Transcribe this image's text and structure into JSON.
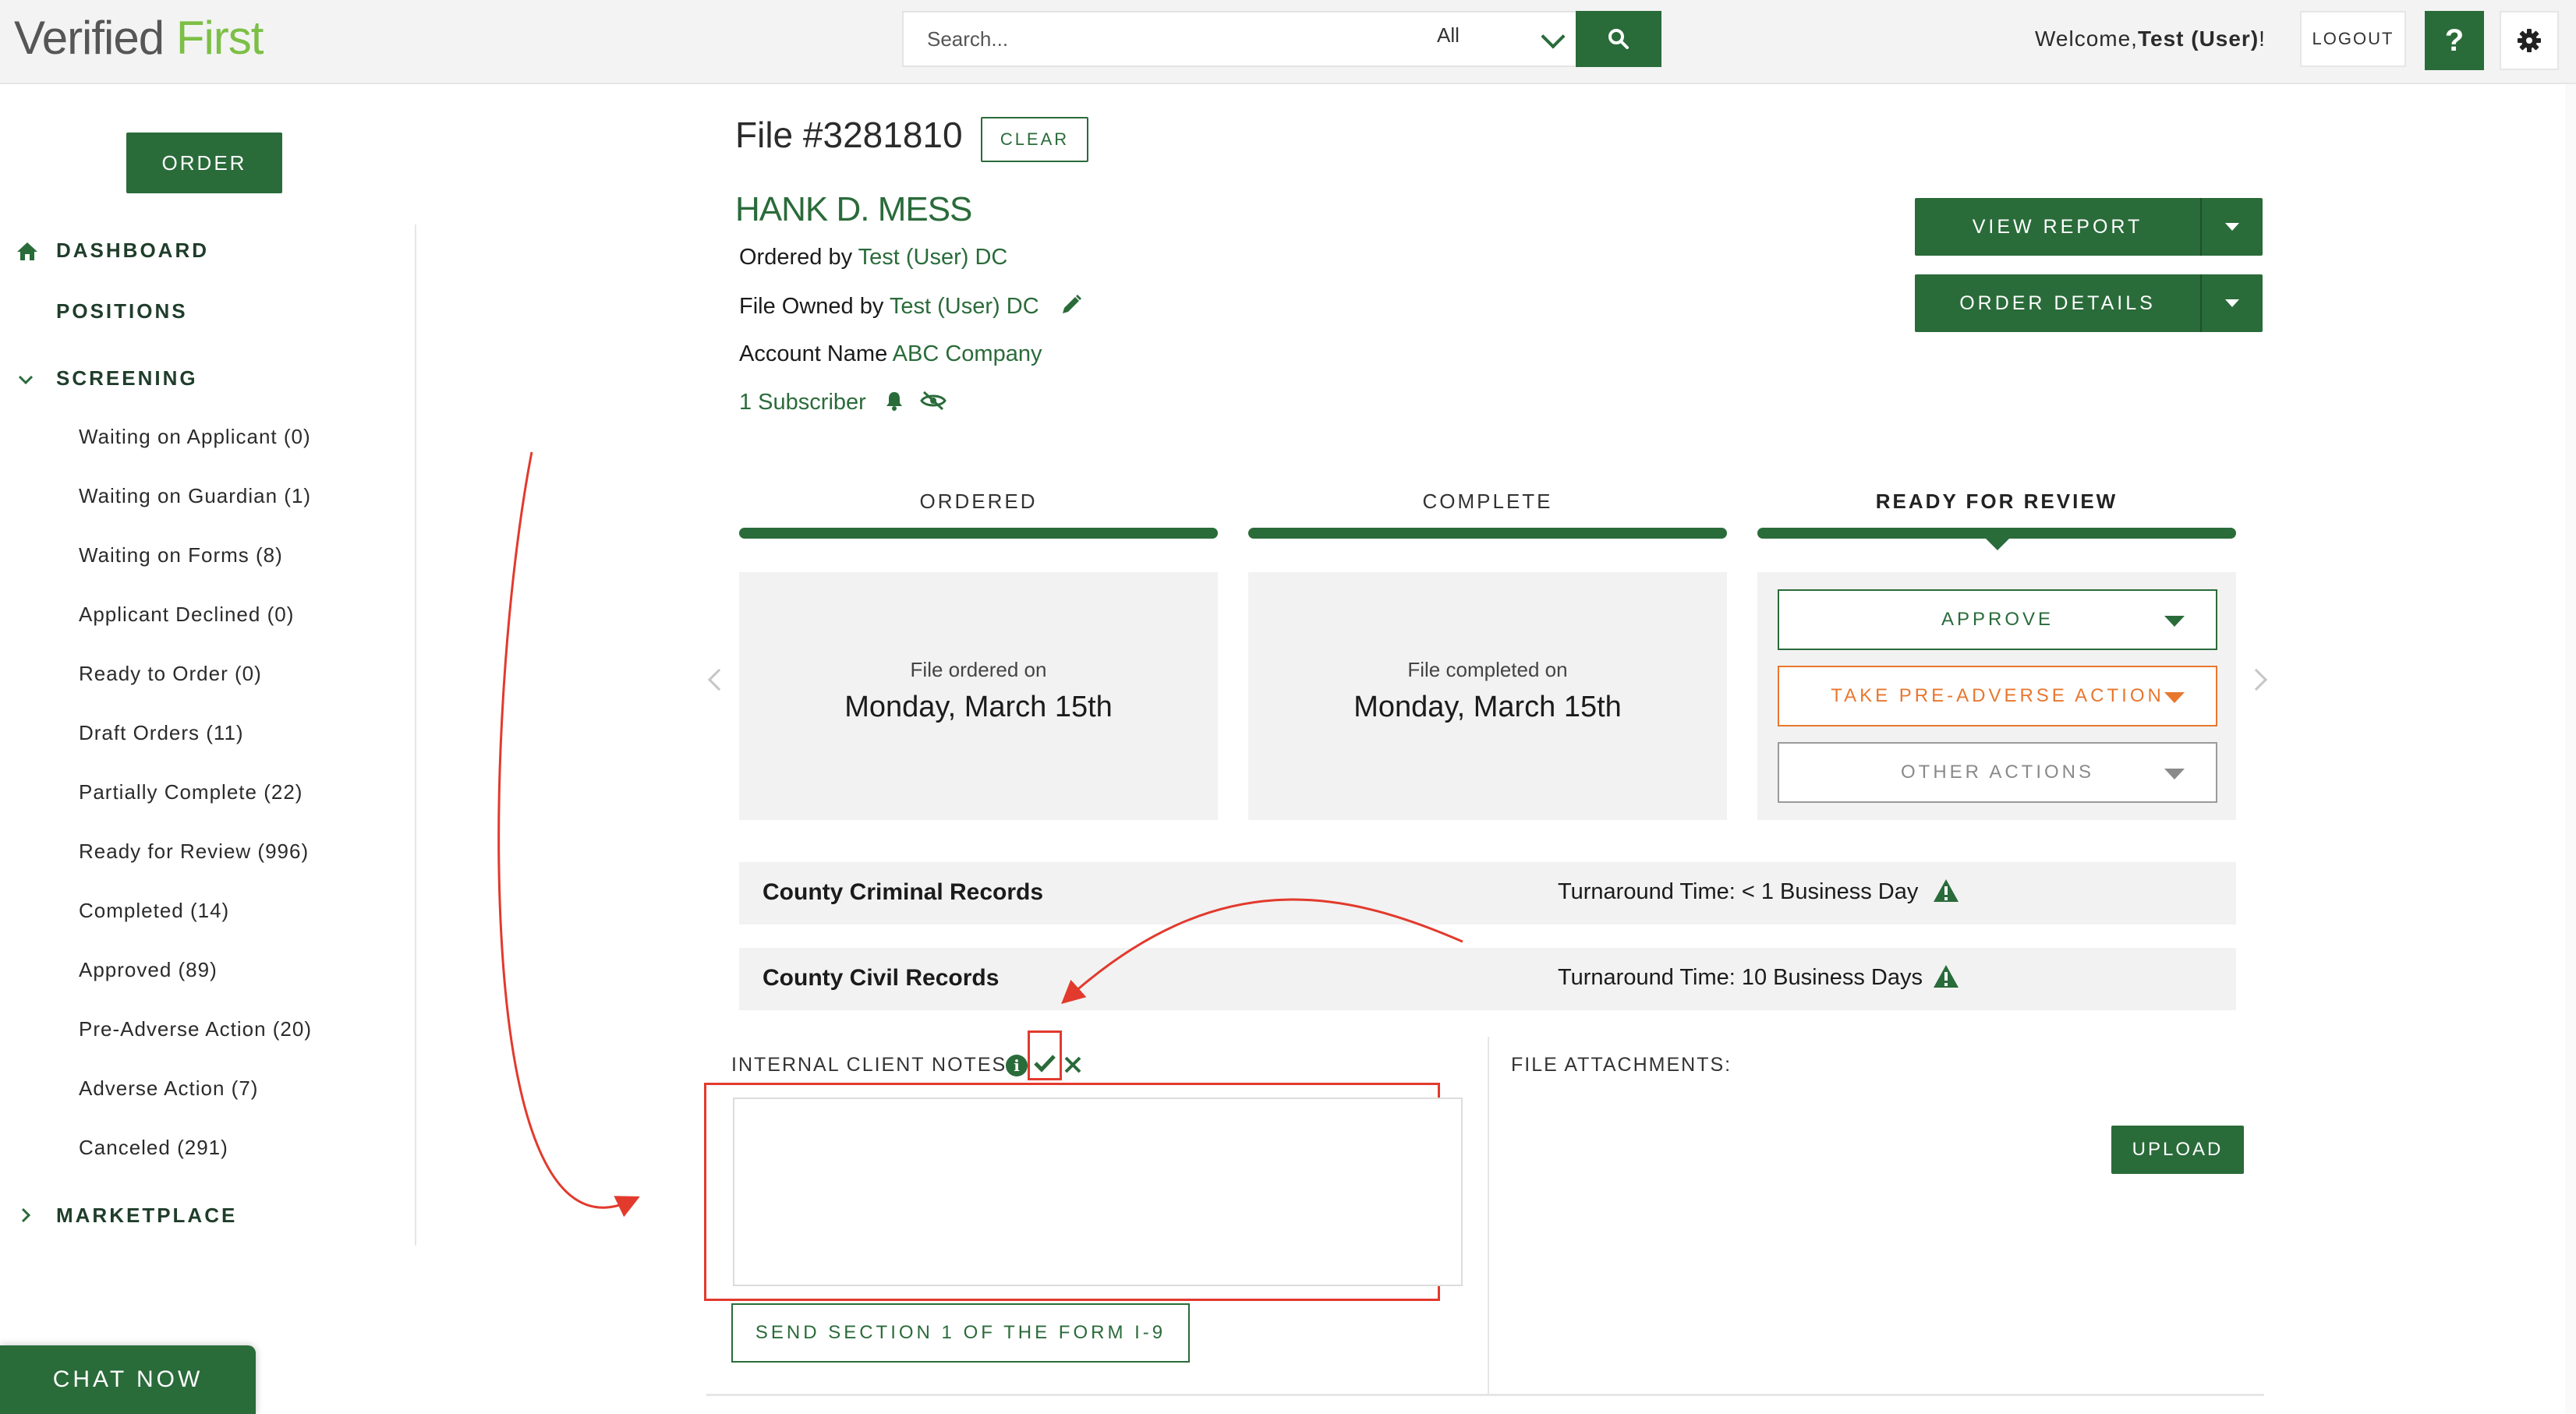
{
  "header": {
    "logo_part1": "Verified",
    "logo_part2": "First",
    "search_placeholder": "Search...",
    "search_scope": "All",
    "welcome_prefix": "Welcome,",
    "welcome_user": "Test (User)",
    "welcome_suffix": "!",
    "logout_label": "LOGOUT",
    "help_label": "?"
  },
  "sidebar": {
    "order_label": "ORDER",
    "dashboard_label": "DASHBOARD",
    "positions_label": "POSITIONS",
    "screening_label": "SCREENING",
    "screening_items": [
      "Waiting on Applicant (0)",
      "Waiting on Guardian (1)",
      "Waiting on Forms (8)",
      "Applicant Declined (0)",
      "Ready to Order (0)",
      "Draft Orders (11)",
      "Partially Complete (22)",
      "Ready for Review (996)",
      "Completed (14)",
      "Approved (89)",
      "Pre-Adverse Action (20)",
      "Adverse Action (7)",
      "Canceled (291)"
    ],
    "marketplace_label": "MARKETPLACE",
    "chat_label": "CHAT NOW"
  },
  "file": {
    "title": "File #3281810",
    "clear_label": "CLEAR",
    "applicant_name": "HANK D. MESS",
    "ordered_by_label": "Ordered by",
    "ordered_by_value": "Test (User) DC",
    "owned_by_label": "File Owned by",
    "owned_by_value": "Test (User) DC",
    "account_label": "Account Name",
    "account_value": "ABC Company",
    "subscribers": "1 Subscriber",
    "view_report_label": "VIEW REPORT",
    "order_details_label": "ORDER DETAILS"
  },
  "timeline": {
    "stages": [
      {
        "label": "ORDERED",
        "card_label": "File ordered on",
        "card_date": "Monday, March 15th"
      },
      {
        "label": "COMPLETE",
        "card_label": "File completed on",
        "card_date": "Monday, March 15th"
      },
      {
        "label": "READY FOR REVIEW"
      }
    ],
    "actions": {
      "approve": "APPROVE",
      "pre_adverse": "TAKE PRE-ADVERSE ACTION",
      "other": "OTHER ACTIONS"
    }
  },
  "records": [
    {
      "name": "County Criminal Records",
      "tat": "Turnaround Time: < 1 Business Day"
    },
    {
      "name": "County Civil Records",
      "tat": "Turnaround Time: 10 Business Days"
    }
  ],
  "notes": {
    "label": "INTERNAL CLIENT NOTES:",
    "info": "i",
    "value": "",
    "send_label": "SEND SECTION 1 OF THE FORM I-9"
  },
  "attachments": {
    "label": "FILE ATTACHMENTS:",
    "upload_label": "UPLOAD"
  },
  "colors": {
    "brand_green": "#2a6b3a",
    "logo_green": "#7cbf45",
    "warning_orange": "#e8772e",
    "annotation_red": "#e23a2d"
  }
}
